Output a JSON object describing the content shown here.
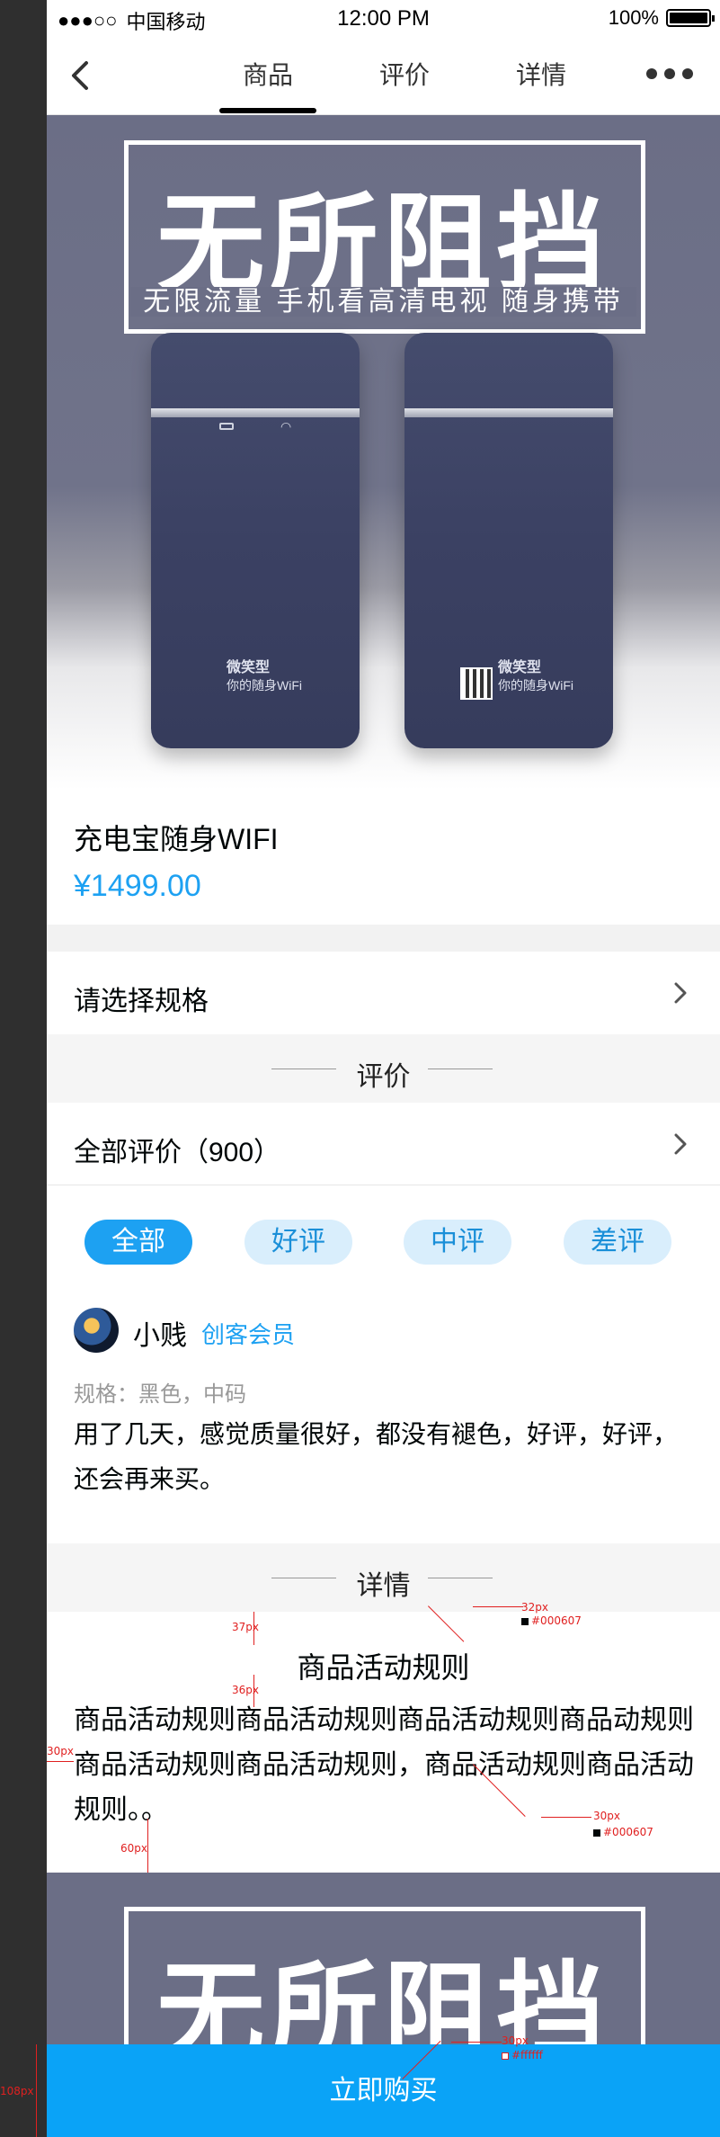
{
  "status_bar": {
    "signal": "●●●○○",
    "carrier": "中国移动",
    "time": "12:00 PM",
    "battery": "100%"
  },
  "nav": {
    "back_icon": "chevron-left-icon",
    "tabs": [
      {
        "label": "商品",
        "active": true
      },
      {
        "label": "评价",
        "active": false
      },
      {
        "label": "详情",
        "active": false
      }
    ],
    "more_icon": "more-dots-icon"
  },
  "banner": {
    "title": "无所阻挡",
    "subtitle": "无限流量  手机看高清电视  随身携带",
    "device_brand": "微笑型",
    "device_tagline": "你的随身WiFi"
  },
  "product": {
    "name": "充电宝随身WIFI",
    "price": "¥1499.00",
    "price_color": "#1da1f2"
  },
  "spec": {
    "label": "请选择规格"
  },
  "reviews_section": {
    "title": "评价",
    "all_label": "全部评价（900）",
    "filters": [
      {
        "label": "全部",
        "active": true
      },
      {
        "label": "好评",
        "active": false
      },
      {
        "label": "中评",
        "active": false
      },
      {
        "label": "差评",
        "active": false
      }
    ],
    "review": {
      "user": "小贱",
      "badge": "创客会员",
      "spec": "规格：黑色，中码",
      "text": "用了几天，感觉质量很好，都没有褪色，好评，好评，还会再来买。"
    }
  },
  "details_section": {
    "title": "详情",
    "heading": "商品活动规则",
    "body": "商品活动规则商品活动规则商品活动规则商品动规则商品活动规则商品活动规则，商品活动规则商品活动规则。。"
  },
  "buy_button": {
    "label": "立即购买",
    "color": "#0aa3f7"
  },
  "annotations": {
    "a1": "32px",
    "a1_color": "#000607",
    "a2": "37px",
    "a3": "36px",
    "a4": "30px",
    "a5": "30px",
    "a5_color": "#000607",
    "a6": "60px",
    "a7": "30px",
    "a7_color": "#ffffff",
    "a8": "108px"
  }
}
